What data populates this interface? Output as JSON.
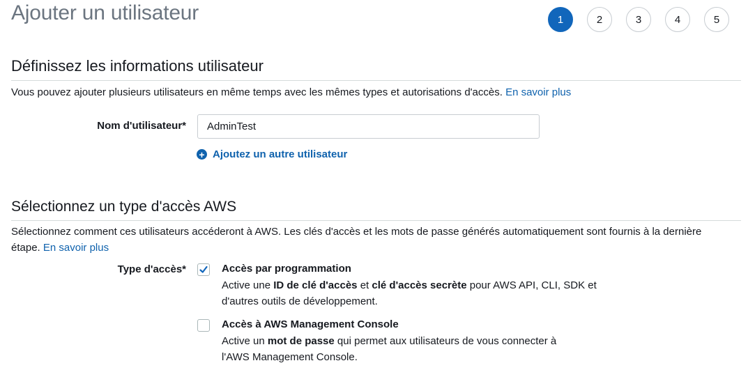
{
  "page": {
    "title": "Ajouter un utilisateur"
  },
  "steps": [
    "1",
    "2",
    "3",
    "4",
    "5"
  ],
  "section1": {
    "title": "Définissez les informations utilisateur",
    "description": "Vous pouvez ajouter plusieurs utilisateurs en même temps avec les mêmes types et autorisations d'accès.",
    "learn_more": "En savoir plus",
    "username_label": "Nom d'utilisateur*",
    "username_value": "AdminTest",
    "add_user": "Ajoutez un autre utilisateur"
  },
  "section2": {
    "title": "Sélectionnez un type d'accès AWS",
    "description_line1": "Sélectionnez comment ces utilisateurs accéderont à AWS. Les clés d'accès et les mots de passe générés automatiquement sont fournis à la dernière",
    "description_line2": "étape.",
    "learn_more": "En savoir plus",
    "access_label": "Type d'accès*",
    "options": [
      {
        "title": "Accès par programmation",
        "checked": true,
        "desc_prefix": "Active une ",
        "desc_bold1": "ID de clé d'accès",
        "desc_mid": " et ",
        "desc_bold2": "clé d'accès secrète",
        "desc_suffix": " pour AWS API, CLI, SDK et",
        "desc_line2": "d'autres outils de développement."
      },
      {
        "title": "Accès à AWS Management Console",
        "checked": false,
        "desc_prefix": "Active un ",
        "desc_bold1": "mot de passe",
        "desc_suffix": " qui permet aux utilisateurs de vous connecter à",
        "desc_line2": "l'AWS Management Console."
      }
    ]
  },
  "colors": {
    "accent": "#1166bb",
    "link": "#0f62ad",
    "divider": "#d5dbdb"
  },
  "icons": {
    "add": "plus-circle-icon",
    "check": "checkmark-icon"
  }
}
